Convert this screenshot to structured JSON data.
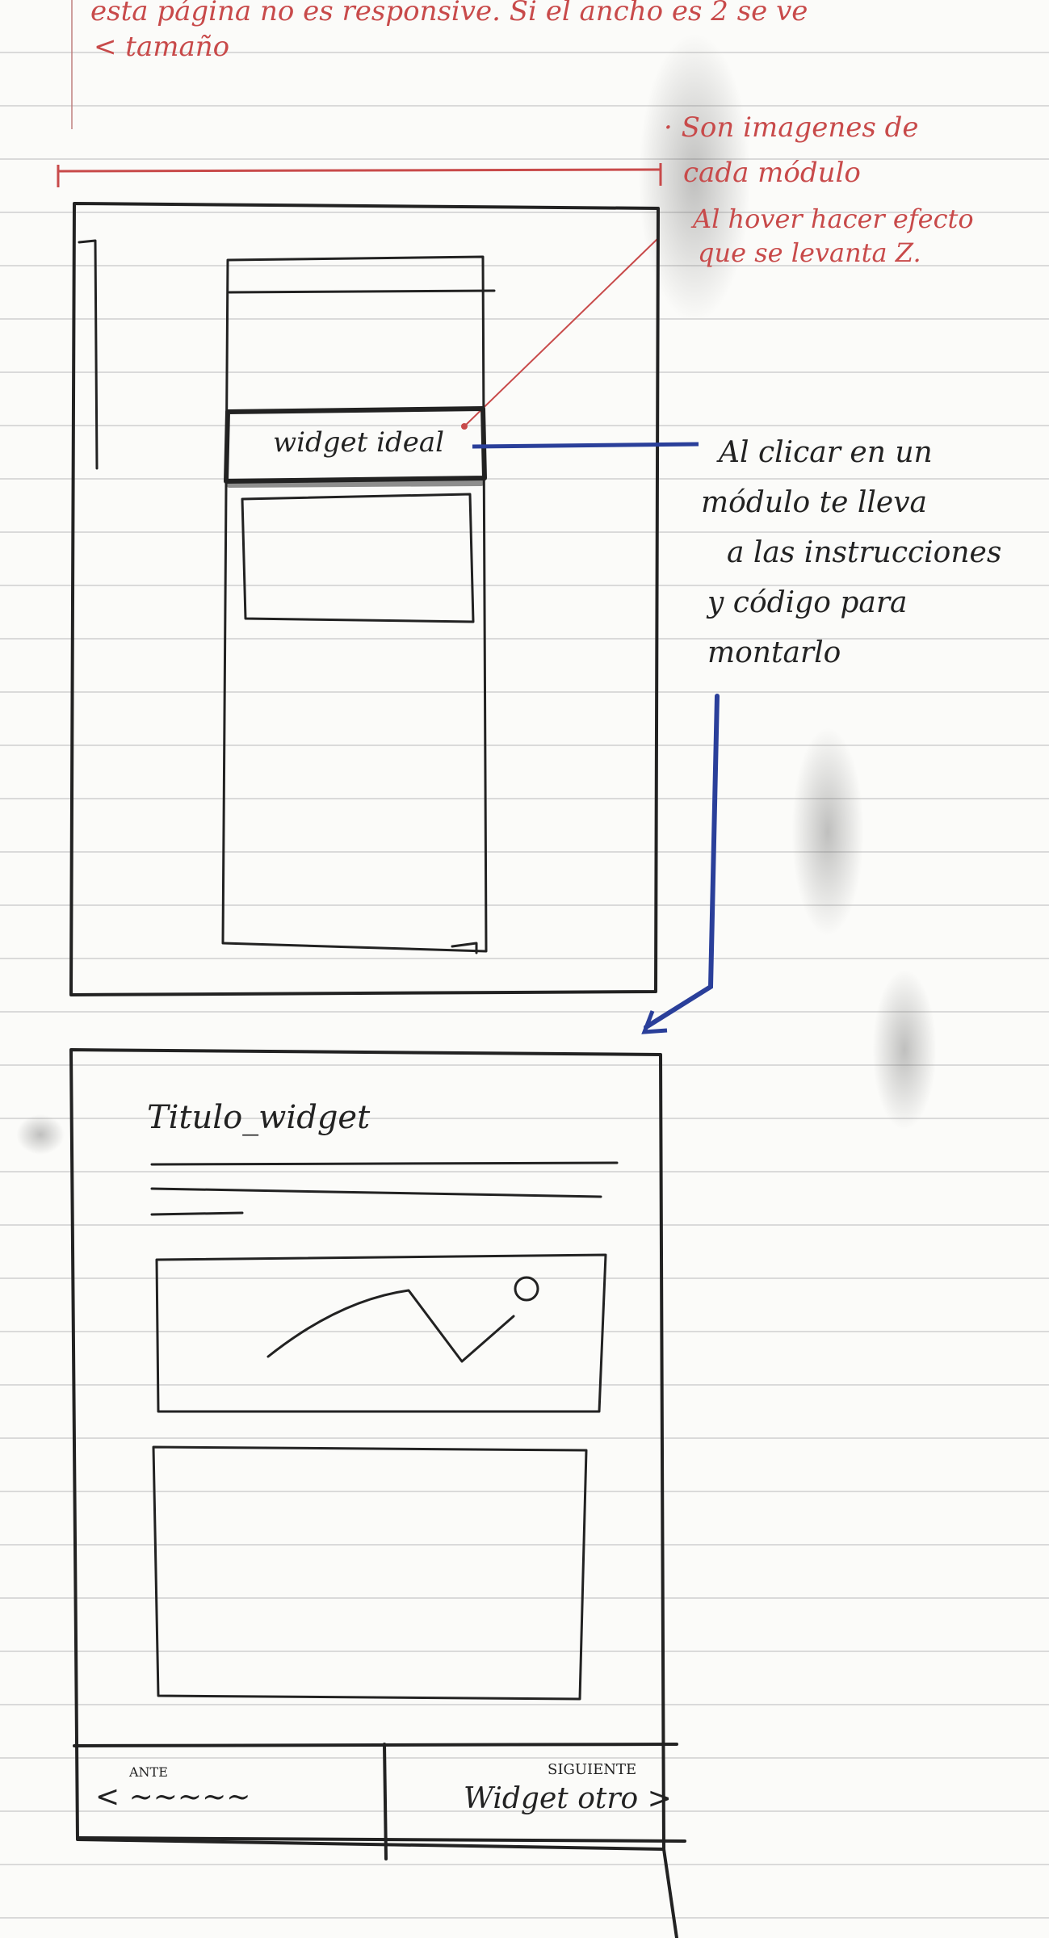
{
  "notes": {
    "top_line_1": "esta página no es responsive. Si el ancho es 2 se ve",
    "top_line_2": "< tamaño",
    "red_note_1": "· Son imagenes de",
    "red_note_2": "cada módulo",
    "red_note_3": "Al hover hacer efecto",
    "red_note_4": "que se levanta Z.",
    "blue_note": [
      "Al clicar en un",
      "módulo te lleva",
      "a las instrucciones",
      "y código para",
      "montarlo"
    ]
  },
  "wireframe_1": {
    "selected_module_label": "widget ideal"
  },
  "wireframe_2": {
    "title": "Titulo_widget",
    "nav": {
      "prev_small": "ANTE",
      "prev_label": "< ~~~~~",
      "next_small": "SIGUIENTE",
      "next_label": "Widget otro >"
    }
  },
  "colors": {
    "ink": "#222222",
    "red_ink": "#c84a4a",
    "blue_ink": "#2a3f9a",
    "paper": "#fbfbf9",
    "rule": "#c9c9c9"
  }
}
